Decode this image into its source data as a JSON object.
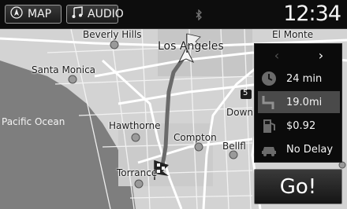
{
  "topbar": {
    "map_label": "MAP",
    "audio_label": "AUDIO",
    "clock": "12:34"
  },
  "map": {
    "labels": {
      "beverly_hills": "Beverly Hills",
      "los_angeles": "Los Angeles",
      "el_monte": "El Monte",
      "santa_monica": "Santa Monica",
      "pacific_ocean": "Pacific Ocean",
      "hawthorne": "Hawthorne",
      "compton": "Compton",
      "downey": "Down",
      "bellflower": "Bellfl",
      "torrance": "Torrance"
    },
    "highway_shield": "5"
  },
  "route_panel": {
    "time": "24 min",
    "distance": "19.0mi",
    "cost": "$0.92",
    "traffic": "No Delay",
    "go_label": "Go!"
  },
  "colors": {
    "route": "#2c2c2c",
    "map_bg": "#d7d7d7",
    "water": "#7d7d7d",
    "road": "#ffffff"
  }
}
